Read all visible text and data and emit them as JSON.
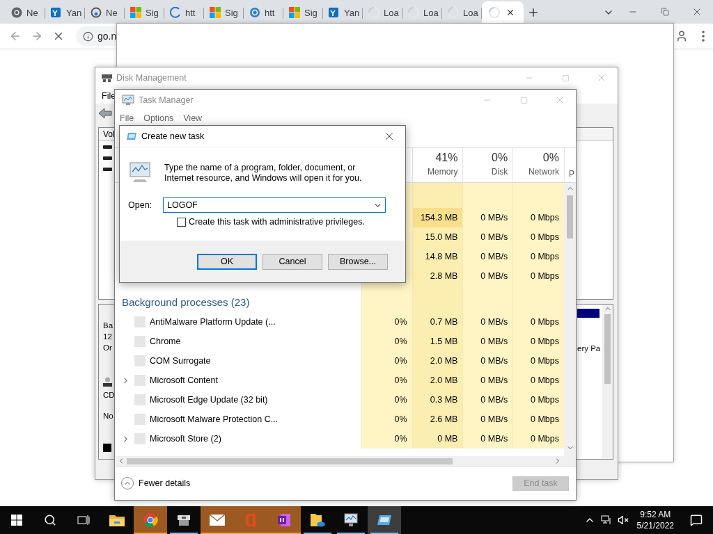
{
  "browser": {
    "tabs": [
      {
        "kind": "chrome",
        "label": "Ne",
        "selected": false
      },
      {
        "kind": "yammer",
        "label": "Yan",
        "selected": false
      },
      {
        "kind": "edge",
        "label": "Ne",
        "selected": false
      },
      {
        "kind": "windows",
        "label": "Sig",
        "selected": false
      },
      {
        "kind": "spinner",
        "label": "htt",
        "selected": false
      },
      {
        "kind": "windows",
        "label": "Sig",
        "selected": false
      },
      {
        "kind": "sync",
        "label": "htt",
        "selected": false
      },
      {
        "kind": "windows",
        "label": "Sig",
        "selected": false
      },
      {
        "kind": "yammer",
        "label": "Yan",
        "selected": false
      },
      {
        "kind": "loading",
        "label": "Loa",
        "selected": false
      },
      {
        "kind": "loading",
        "label": "Loa",
        "selected": false
      },
      {
        "kind": "loading",
        "label": "Loa",
        "selected": false
      },
      {
        "kind": "loading",
        "selected": true
      }
    ],
    "address": "go.n"
  },
  "disk_management": {
    "title": "Disk Management",
    "menu": [
      "File"
    ],
    "list_header": "Vol",
    "graph_labels": [
      "Ba",
      "12",
      "Or"
    ],
    "cd_label": "CD",
    "cd_status": "No",
    "partition_label": "ery Pa"
  },
  "task_manager": {
    "title": "Task Manager",
    "menu": [
      "File",
      "Options",
      "View"
    ],
    "columns": [
      {
        "percent": "41%",
        "label": "Memory"
      },
      {
        "percent": "0%",
        "label": "Disk"
      },
      {
        "percent": "0%",
        "label": "Network"
      },
      {
        "label": "P"
      }
    ],
    "top_rows": [
      {
        "memory": "154.3 MB",
        "disk": "0 MB/s",
        "network": "0 Mbps"
      },
      {
        "memory": "15.0 MB",
        "disk": "0 MB/s",
        "network": "0 Mbps"
      },
      {
        "memory": "14.8 MB",
        "disk": "0 MB/s",
        "network": "0 Mbps"
      },
      {
        "memory": "2.8 MB",
        "disk": "0 MB/s",
        "network": "0 Mbps"
      }
    ],
    "group": "Background processes (23)",
    "rows": [
      {
        "name": "AntiMalware Platform Update (...",
        "expandable": false,
        "cpu": "0%",
        "memory": "0.7 MB",
        "disk": "0 MB/s",
        "network": "0 Mbps"
      },
      {
        "name": "Chrome",
        "expandable": false,
        "cpu": "0%",
        "memory": "1.5 MB",
        "disk": "0 MB/s",
        "network": "0 Mbps"
      },
      {
        "name": "COM Surrogate",
        "expandable": false,
        "cpu": "0%",
        "memory": "2.0 MB",
        "disk": "0 MB/s",
        "network": "0 Mbps"
      },
      {
        "name": "Microsoft Content",
        "expandable": true,
        "cpu": "0%",
        "memory": "2.0 MB",
        "disk": "0 MB/s",
        "network": "0 Mbps"
      },
      {
        "name": "Microsoft Edge Update (32 bit)",
        "expandable": false,
        "cpu": "0%",
        "memory": "0.3 MB",
        "disk": "0 MB/s",
        "network": "0 Mbps"
      },
      {
        "name": "Microsoft Malware Protection C...",
        "expandable": false,
        "cpu": "0%",
        "memory": "2.6 MB",
        "disk": "0 MB/s",
        "network": "0 Mbps"
      },
      {
        "name": "Microsoft Store (2)",
        "expandable": true,
        "cpu": "0%",
        "memory": "0 MB",
        "disk": "0 MB/s",
        "network": "0 Mbps"
      }
    ],
    "fewer_details": "Fewer details",
    "end_task": {
      "label": "End task",
      "disabled": true
    }
  },
  "dialog": {
    "title": "Create new task",
    "message": "Type the name of a program, folder, document, or Internet resource, and Windows will open it for you.",
    "open_label": "Open:",
    "value": "LOGOF",
    "checkbox": {
      "label": "Create this task with administrative privileges.",
      "checked": false
    },
    "buttons": [
      {
        "label": "OK",
        "default": true
      },
      {
        "label": "Cancel",
        "default": false
      },
      {
        "label": "Browse...",
        "default": false
      }
    ]
  },
  "taskbar": {
    "apps": [
      {
        "kind": "explorer",
        "running": false,
        "flashing": false,
        "selected": false
      },
      {
        "kind": "chrome",
        "running": true,
        "flashing": true,
        "selected": false
      },
      {
        "kind": "package",
        "running": true,
        "flashing": false,
        "selected": false
      },
      {
        "kind": "mail",
        "running": true,
        "flashing": true,
        "selected": false
      },
      {
        "kind": "office",
        "running": true,
        "flashing": true,
        "selected": false
      },
      {
        "kind": "onenote",
        "running": true,
        "flashing": true,
        "selected": false
      },
      {
        "kind": "onedrive-folder",
        "running": true,
        "flashing": false,
        "selected": false
      },
      {
        "kind": "task-manager",
        "running": true,
        "flashing": false,
        "selected": false
      },
      {
        "kind": "run",
        "running": true,
        "flashing": false,
        "selected": true
      }
    ],
    "time": "9:52 AM",
    "date": "5/21/2022"
  }
}
